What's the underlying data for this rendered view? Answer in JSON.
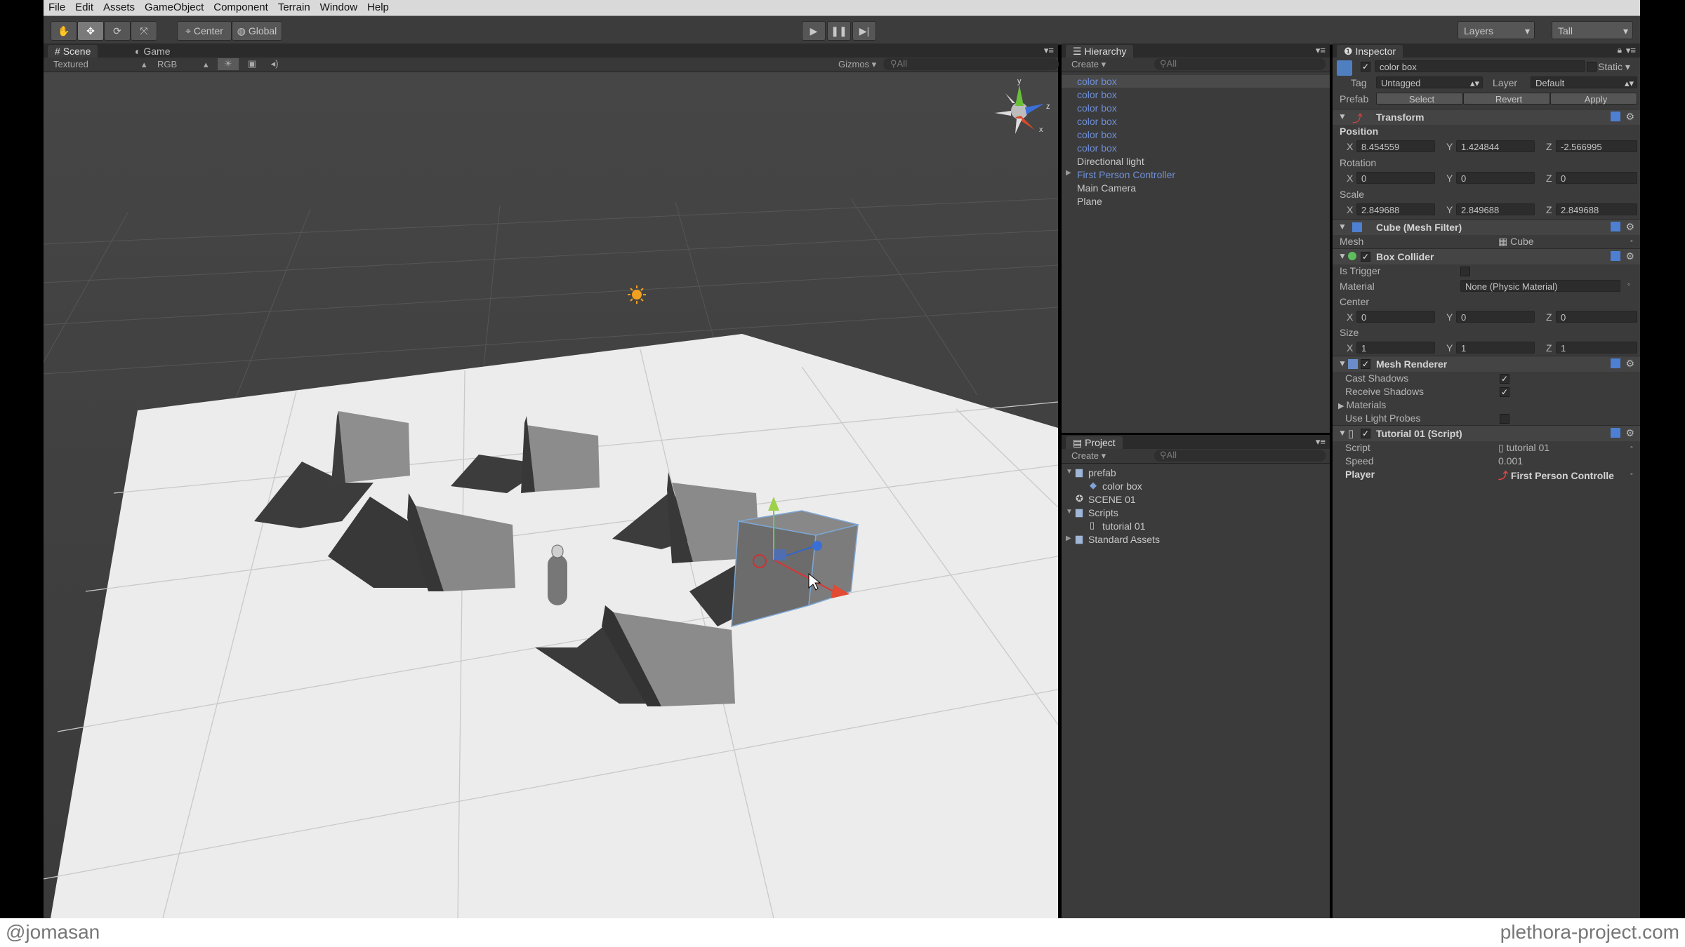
{
  "menu": [
    "File",
    "Edit",
    "Assets",
    "GameObject",
    "Component",
    "Terrain",
    "Window",
    "Help"
  ],
  "toolbar": {
    "tools": [
      "hand-icon",
      "move-icon",
      "rotate-icon",
      "scale-icon"
    ],
    "pivot": "Center",
    "space": "Global",
    "layers": "Layers",
    "layout": "Tall"
  },
  "scene_panel": {
    "tabs": [
      "Scene",
      "Game"
    ],
    "render_mode": "Textured",
    "color_mode": "RGB",
    "gizmos": "Gizmos",
    "search": "All",
    "axes": {
      "y": "y",
      "x": "x",
      "z": "z"
    }
  },
  "hierarchy": {
    "title": "Hierarchy",
    "create": "Create",
    "search": "All",
    "items": [
      {
        "label": "color box",
        "prefab": true,
        "selected": true
      },
      {
        "label": "color box",
        "prefab": true
      },
      {
        "label": "color box",
        "prefab": true
      },
      {
        "label": "color box",
        "prefab": true
      },
      {
        "label": "color box",
        "prefab": true
      },
      {
        "label": "color box",
        "prefab": true
      },
      {
        "label": "Directional light",
        "prefab": false
      },
      {
        "label": "First Person Controller",
        "prefab": true,
        "expandable": true
      },
      {
        "label": "Main Camera",
        "prefab": false
      },
      {
        "label": "Plane",
        "prefab": false
      }
    ]
  },
  "project": {
    "title": "Project",
    "create": "Create",
    "search": "All",
    "items": [
      {
        "label": "prefab",
        "type": "folder",
        "indent": 0,
        "open": true
      },
      {
        "label": "color box",
        "type": "prefab",
        "indent": 1
      },
      {
        "label": "SCENE 01",
        "type": "scene",
        "indent": 0
      },
      {
        "label": "Scripts",
        "type": "folder",
        "indent": 0,
        "open": true
      },
      {
        "label": "tutorial 01",
        "type": "script",
        "indent": 1
      },
      {
        "label": "Standard Assets",
        "type": "folder",
        "indent": 0
      }
    ]
  },
  "inspector": {
    "title": "Inspector",
    "object_name": "color box",
    "static": "Static",
    "tag_label": "Tag",
    "tag": "Untagged",
    "layer_label": "Layer",
    "layer": "Default",
    "prefab_label": "Prefab",
    "prefab_buttons": [
      "Select",
      "Revert",
      "Apply"
    ],
    "transform": {
      "title": "Transform",
      "position_label": "Position",
      "position": {
        "x": "8.454559",
        "y": "1.424844",
        "z": "-2.566995"
      },
      "rotation_label": "Rotation",
      "rotation": {
        "x": "0",
        "y": "0",
        "z": "0"
      },
      "scale_label": "Scale",
      "scale": {
        "x": "2.849688",
        "y": "2.849688",
        "z": "2.849688"
      }
    },
    "mesh_filter": {
      "title": "Cube (Mesh Filter)",
      "mesh_label": "Mesh",
      "mesh": "Cube"
    },
    "box_collider": {
      "title": "Box Collider",
      "is_trigger_label": "Is Trigger",
      "material_label": "Material",
      "material": "None (Physic Material)",
      "center_label": "Center",
      "center": {
        "x": "0",
        "y": "0",
        "z": "0"
      },
      "size_label": "Size",
      "size": {
        "x": "1",
        "y": "1",
        "z": "1"
      }
    },
    "mesh_renderer": {
      "title": "Mesh Renderer",
      "cast_shadows": "Cast Shadows",
      "receive_shadows": "Receive Shadows",
      "materials": "Materials",
      "use_light_probes": "Use Light Probes"
    },
    "script": {
      "title": "Tutorial 01 (Script)",
      "script_label": "Script",
      "script": "tutorial 01",
      "speed_label": "Speed",
      "speed": "0.001",
      "player_label": "Player",
      "player": "First Person Controlle"
    }
  },
  "footer": {
    "left": "@jomasan",
    "right": "plethora-project.com"
  }
}
